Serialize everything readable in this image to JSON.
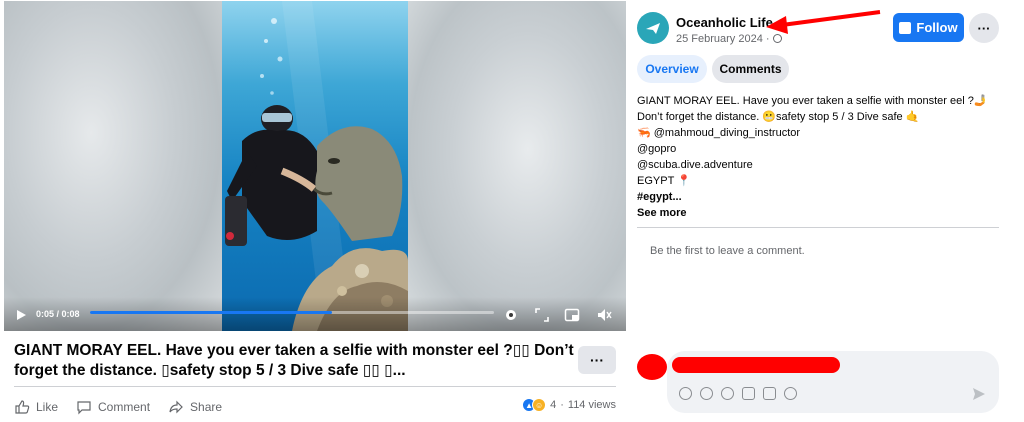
{
  "video": {
    "time": "0:05 / 0:08",
    "progress_fraction": 0.6
  },
  "post": {
    "title": "GIANT MORAY EEL. Have you ever taken a selfie with monster eel ?▯▯ Don’t forget the distance. ▯safety stop 5 / 3 Dive safe ▯▯ ▯...",
    "more_label": "···",
    "actions": {
      "like": "Like",
      "comment": "Comment",
      "share": "Share"
    },
    "reactions": {
      "count": "4",
      "views": "114 views"
    }
  },
  "page": {
    "name": "Oceanholic Life",
    "date": "25 February 2024 ·",
    "follow_label": "Follow",
    "dots_label": "···"
  },
  "tabs": {
    "overview": "Overview",
    "comments": "Comments"
  },
  "caption": {
    "line1": "GIANT MORAY EEL. Have you ever taken a selfie with monster eel ?🤳",
    "line2": "Don’t forget the distance. 😬safety stop 5 / 3 Dive safe 🤙",
    "line3": "🦐 @mahmoud_diving_instructor",
    "line4": "@gopro",
    "line5": "@scuba.dive.adventure",
    "line6": "EGYPT 📍",
    "line7": "#egypt...",
    "see_more": "See more"
  },
  "comments": {
    "empty_text": "Be the first to leave a comment."
  },
  "colors": {
    "accent": "#1877f2",
    "redaction": "#ff0000",
    "avatar": "#2aa6b8"
  }
}
